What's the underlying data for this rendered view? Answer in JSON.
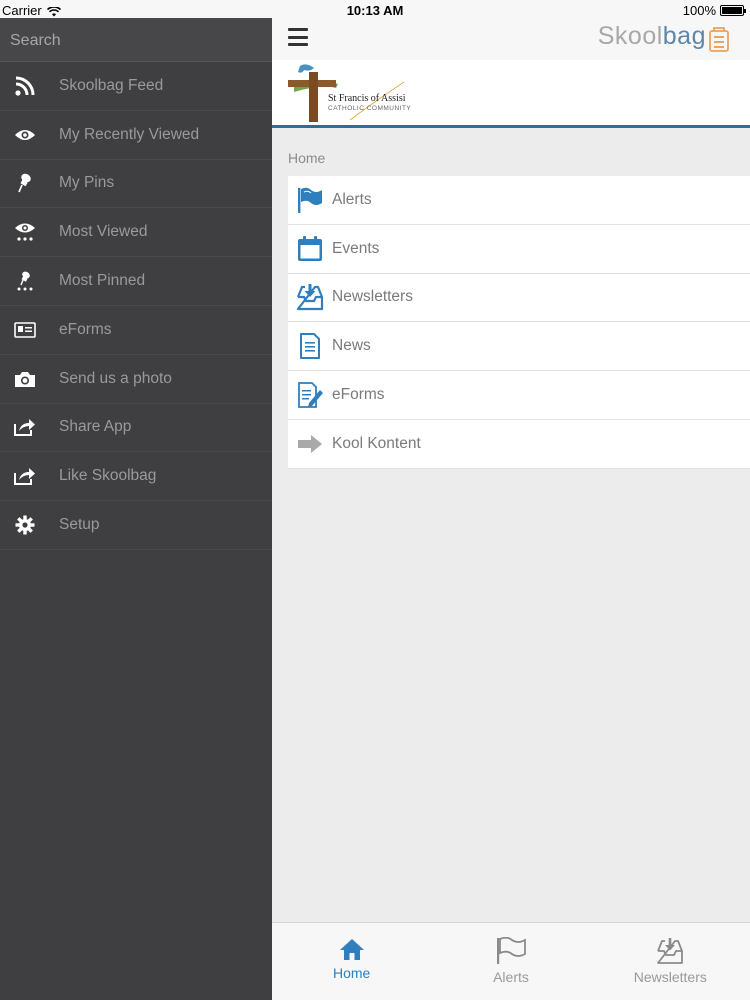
{
  "status": {
    "carrier": "Carrier",
    "time": "10:13 AM",
    "battery": "100%"
  },
  "sidebar": {
    "search_placeholder": "Search",
    "items": [
      {
        "label": "Skoolbag Feed",
        "icon": "rss-icon"
      },
      {
        "label": "My Recently Viewed",
        "icon": "eye-icon"
      },
      {
        "label": "My Pins",
        "icon": "pin-icon"
      },
      {
        "label": "Most Viewed",
        "icon": "eye-dots-icon"
      },
      {
        "label": "Most Pinned",
        "icon": "pin-dots-icon"
      },
      {
        "label": "eForms",
        "icon": "id-card-icon"
      },
      {
        "label": "Send us a photo",
        "icon": "camera-icon"
      },
      {
        "label": "Share App",
        "icon": "share-icon"
      },
      {
        "label": "Like Skoolbag",
        "icon": "share-icon"
      },
      {
        "label": "Setup",
        "icon": "gear-icon"
      }
    ]
  },
  "header": {
    "brand": "Skool",
    "brand_suffix": "bag",
    "school_name": "St Francis of Assisi",
    "school_sub": "CATHOLIC COMMUNITY",
    "accent": "#2e6f8f"
  },
  "breadcrumb": "Home",
  "list": [
    {
      "label": "Alerts",
      "icon": "flag-icon"
    },
    {
      "label": "Events",
      "icon": "calendar-icon"
    },
    {
      "label": "Newsletters",
      "icon": "inbox-download-icon"
    },
    {
      "label": "News",
      "icon": "document-icon"
    },
    {
      "label": "eForms",
      "icon": "form-edit-icon"
    },
    {
      "label": "Kool Kontent",
      "icon": "arrow-right-icon"
    }
  ],
  "tabs": [
    {
      "label": "Home",
      "icon": "home-icon",
      "active": true
    },
    {
      "label": "Alerts",
      "icon": "flag-icon",
      "active": false
    },
    {
      "label": "Newsletters",
      "icon": "inbox-download-icon",
      "active": false
    }
  ],
  "colors": {
    "sidebar_bg": "#3f3e40",
    "icon_blue": "#2f7fbf",
    "tab_active": "#2f7fbf"
  }
}
